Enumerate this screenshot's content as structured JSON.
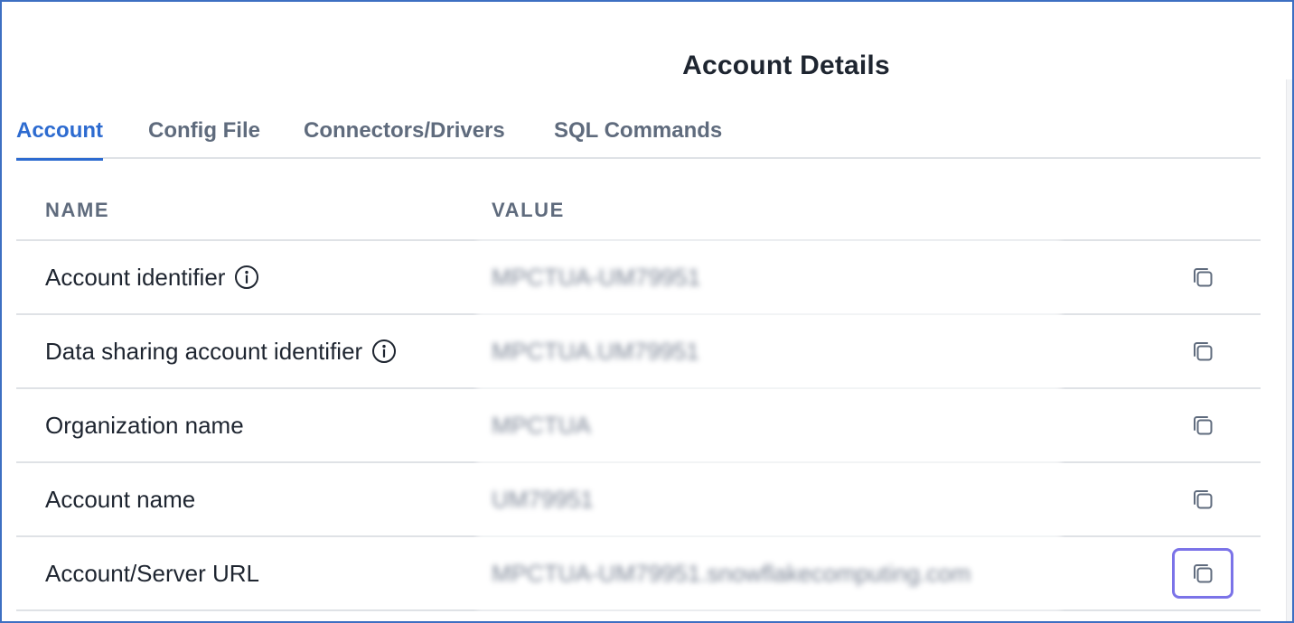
{
  "header": {
    "title": "Account Details"
  },
  "tabs": [
    {
      "label": "Account",
      "active": true
    },
    {
      "label": "Config File",
      "active": false
    },
    {
      "label": "Connectors/Drivers",
      "active": false
    },
    {
      "label": "SQL Commands",
      "active": false
    }
  ],
  "table": {
    "columns": {
      "name": "NAME",
      "value": "VALUE"
    },
    "rows": [
      {
        "name": "Account identifier",
        "value": "MPCTUA-UM79951",
        "info": true
      },
      {
        "name": "Data sharing account identifier",
        "value": "MPCTUA.UM79951",
        "info": true
      },
      {
        "name": "Organization name",
        "value": "MPCTUA",
        "info": false
      },
      {
        "name": "Account name",
        "value": "UM79951",
        "info": false
      },
      {
        "name": "Account/Server URL",
        "value": "MPCTUA-UM79951.snowflakecomputing.com",
        "info": false
      }
    ]
  },
  "icons": {
    "info": "info-circle-icon",
    "copy": "copy-icon"
  },
  "colors": {
    "accent": "#2d6bd0",
    "focus_ring": "#7b73e8",
    "frame_border": "#3d6fc2",
    "text": "#1e2530",
    "muted": "#5f6b7d"
  }
}
